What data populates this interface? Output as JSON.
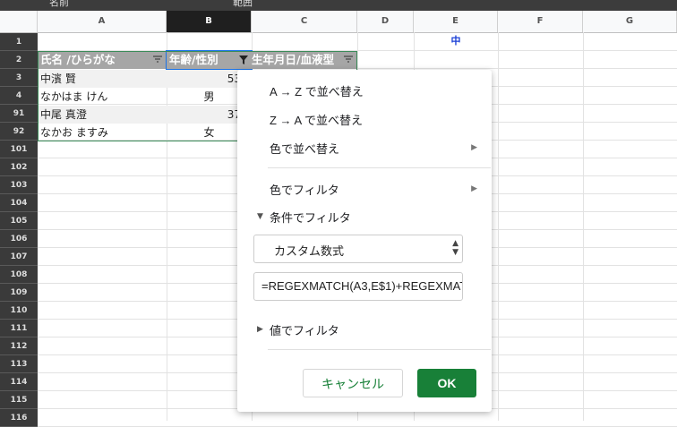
{
  "topbar": {
    "left_text": "名前",
    "mid_text": "範囲"
  },
  "columns": [
    "A",
    "B",
    "C",
    "D",
    "E",
    "F",
    "G"
  ],
  "row_numbers": [
    "1",
    "2",
    "3",
    "4",
    "91",
    "92",
    "101",
    "102",
    "103",
    "104",
    "105",
    "106",
    "107",
    "108",
    "109",
    "110",
    "111",
    "112",
    "113",
    "114",
    "115",
    "116"
  ],
  "header_row": {
    "a": "氏名 /ひらがな",
    "b": "年齢/性別",
    "c": "生年月日/血液型"
  },
  "rows": [
    {
      "a": "中濱 賢",
      "b": "53"
    },
    {
      "a": "なかはま けん",
      "b": "男"
    },
    {
      "a": "中尾 真澄",
      "b": "37"
    },
    {
      "a": "なかお ますみ",
      "b": "女"
    }
  ],
  "e1": "中",
  "menu": {
    "sort_az": "A → Z で並べ替え",
    "sort_za": "Z → A で並べ替え",
    "sort_color": "色で並べ替え",
    "filter_color": "色でフィルタ",
    "filter_condition": "条件でフィルタ",
    "condition_select": "カスタム数式",
    "formula": "=REGEXMATCH(A3,E$1)+REGEXMATC",
    "filter_values": "値でフィルタ",
    "cancel": "キャンセル",
    "ok": "OK"
  },
  "colors": {
    "ok_button": "#188038",
    "header_fill": "#a6a6a6",
    "accent_text": "#1a3fd6"
  }
}
